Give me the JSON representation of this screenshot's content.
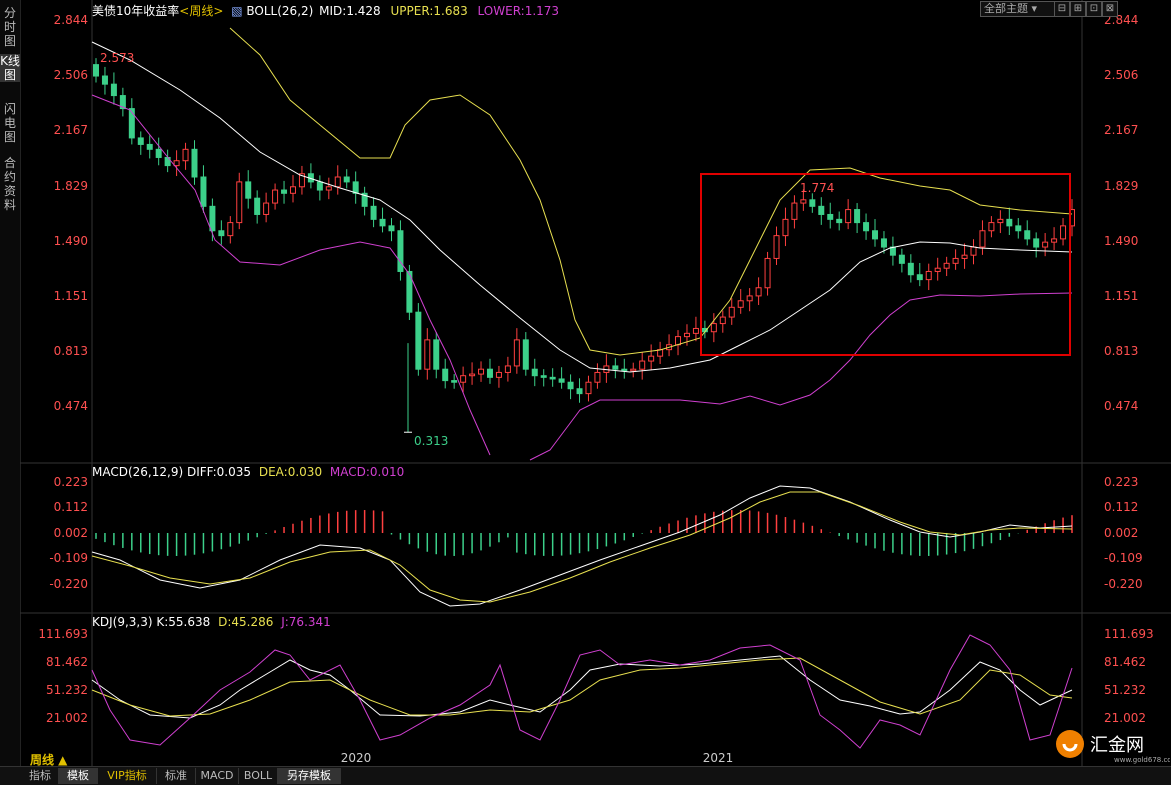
{
  "sidebar": {
    "tabs": [
      {
        "label": "分时图",
        "active": false
      },
      {
        "label": "K线图",
        "active": true
      },
      {
        "label": "闪电图",
        "active": false
      },
      {
        "label": "合约资料",
        "active": false
      }
    ]
  },
  "header": {
    "main": {
      "title": "美债10年收益率",
      "period": "<周线>",
      "indicator": "BOLL(26,2)",
      "mid": "MID:1.428",
      "upper": "UPPER:1.683",
      "lower": "LOWER:1.173"
    },
    "macd": {
      "name": "MACD(26,12,9)",
      "diff": "DIFF:0.035",
      "dea": "DEA:0.030",
      "macd": "MACD:0.010"
    },
    "kdj": {
      "name": "KDJ(9,3,3)",
      "k": "K:55.638",
      "d": "D:45.286",
      "j": "J:76.341"
    },
    "theme_button": "全部主题",
    "window_buttons": [
      "⊟",
      "⊞",
      "⊡",
      "⊠"
    ]
  },
  "price_axis": {
    "ticks": [
      "2.844",
      "2.506",
      "2.167",
      "1.829",
      "1.490",
      "1.151",
      "0.813",
      "0.474"
    ]
  },
  "macd_axis": {
    "ticks": [
      "0.223",
      "0.112",
      "0.002",
      "-0.109",
      "-0.220"
    ]
  },
  "kdj_axis": {
    "ticks": [
      "111.693",
      "81.462",
      "51.232",
      "21.002"
    ]
  },
  "annotations": {
    "high_start": "2.573",
    "low": "0.313",
    "high_2021": "1.774"
  },
  "time_axis": {
    "labels": [
      "2020",
      "2021"
    ]
  },
  "period_label": "周线 ▲",
  "bottom_tabs": [
    {
      "label": "指标",
      "active": false
    },
    {
      "label": "模板",
      "active": true
    },
    {
      "label": "VIP指标",
      "active": false
    },
    {
      "label": "标准",
      "active": false
    },
    {
      "label": "MACD",
      "active": false
    },
    {
      "label": "BOLL",
      "active": false
    },
    {
      "label": "另存模板",
      "active": true
    }
  ],
  "watermark": {
    "brand": "汇金网",
    "url": "www.gold678.com"
  },
  "colors": {
    "up": "#ff4040",
    "down": "#3cd08a",
    "upper": "#e8e050",
    "mid": "#ffffff",
    "lower": "#d040d0",
    "highlight_box": "#e00000"
  },
  "chart_data": [
    {
      "type": "candlestick",
      "title": "美债10年收益率",
      "ylim": [
        0.3,
        2.9
      ],
      "ohlc_close_weekly": [
        2.5,
        2.45,
        2.38,
        2.3,
        2.12,
        2.08,
        2.05,
        2.0,
        1.95,
        1.98,
        2.05,
        1.88,
        1.7,
        1.55,
        1.52,
        1.6,
        1.85,
        1.75,
        1.65,
        1.72,
        1.8,
        1.78,
        1.82,
        1.9,
        1.85,
        1.8,
        1.82,
        1.88,
        1.85,
        1.78,
        1.7,
        1.62,
        1.58,
        1.55,
        1.3,
        1.05,
        0.7,
        0.88,
        0.7,
        0.63,
        0.62,
        0.66,
        0.67,
        0.7,
        0.65,
        0.68,
        0.72,
        0.88,
        0.7,
        0.66,
        0.65,
        0.64,
        0.62,
        0.58,
        0.55,
        0.62,
        0.68,
        0.72,
        0.7,
        0.69,
        0.7,
        0.75,
        0.78,
        0.82,
        0.85,
        0.9,
        0.92,
        0.95,
        0.93,
        0.98,
        1.02,
        1.08,
        1.12,
        1.15,
        1.2,
        1.38,
        1.52,
        1.62,
        1.72,
        1.74,
        1.7,
        1.65,
        1.62,
        1.6,
        1.68,
        1.6,
        1.55,
        1.5,
        1.45,
        1.4,
        1.35,
        1.28,
        1.25,
        1.3,
        1.32,
        1.35,
        1.38,
        1.4,
        1.45,
        1.55,
        1.6,
        1.62,
        1.58,
        1.55,
        1.5,
        1.45,
        1.48,
        1.5,
        1.58,
        1.68
      ],
      "x_labels": [
        "2020",
        "2021"
      ],
      "annotations": [
        "2.573",
        "0.313",
        "1.774"
      ]
    },
    {
      "type": "bar",
      "title": "MACD(26,12,9)",
      "ylim": [
        -0.25,
        0.25
      ]
    },
    {
      "type": "line",
      "title": "KDJ(9,3,3)",
      "ylim": [
        0,
        120
      ]
    }
  ]
}
